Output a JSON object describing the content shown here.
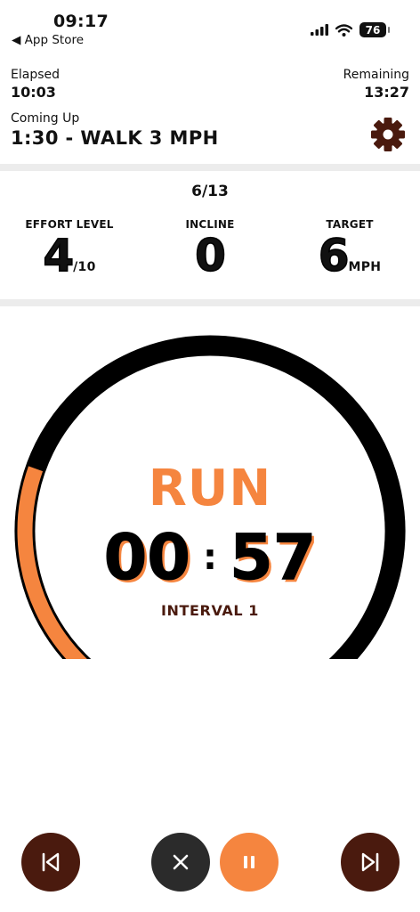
{
  "status_bar": {
    "time": "09:17",
    "back_app": "◀ App Store",
    "battery": "76"
  },
  "header": {
    "elapsed_label": "Elapsed",
    "elapsed_value": "10:03",
    "remaining_label": "Remaining",
    "remaining_value": "13:27",
    "coming_up_label": "Coming Up",
    "coming_up_value": "1:30 - WALK 3 MPH",
    "settings_icon": "gear-icon"
  },
  "stats": {
    "progress": "6/13",
    "effort_label": "EFFORT LEVEL",
    "effort_value": "4",
    "effort_unit": "/10",
    "incline_label": "INCLINE",
    "incline_value": "0",
    "target_label": "TARGET",
    "target_value": "6",
    "target_unit": "MPH"
  },
  "gauge": {
    "fraction_complete": 0.28,
    "phase": "RUN",
    "minutes": "00",
    "separator": ":",
    "seconds": "57",
    "interval_label": "INTERVAL 1"
  },
  "controls": {
    "previous_icon": "skip-previous-icon",
    "stop_icon": "close-icon",
    "pause_icon": "pause-icon",
    "next_icon": "skip-next-icon"
  },
  "colors": {
    "accent": "#f5853f",
    "dark_brown": "#4a1a0e",
    "dark_grey": "#2b2b2b",
    "track": "#000000"
  }
}
